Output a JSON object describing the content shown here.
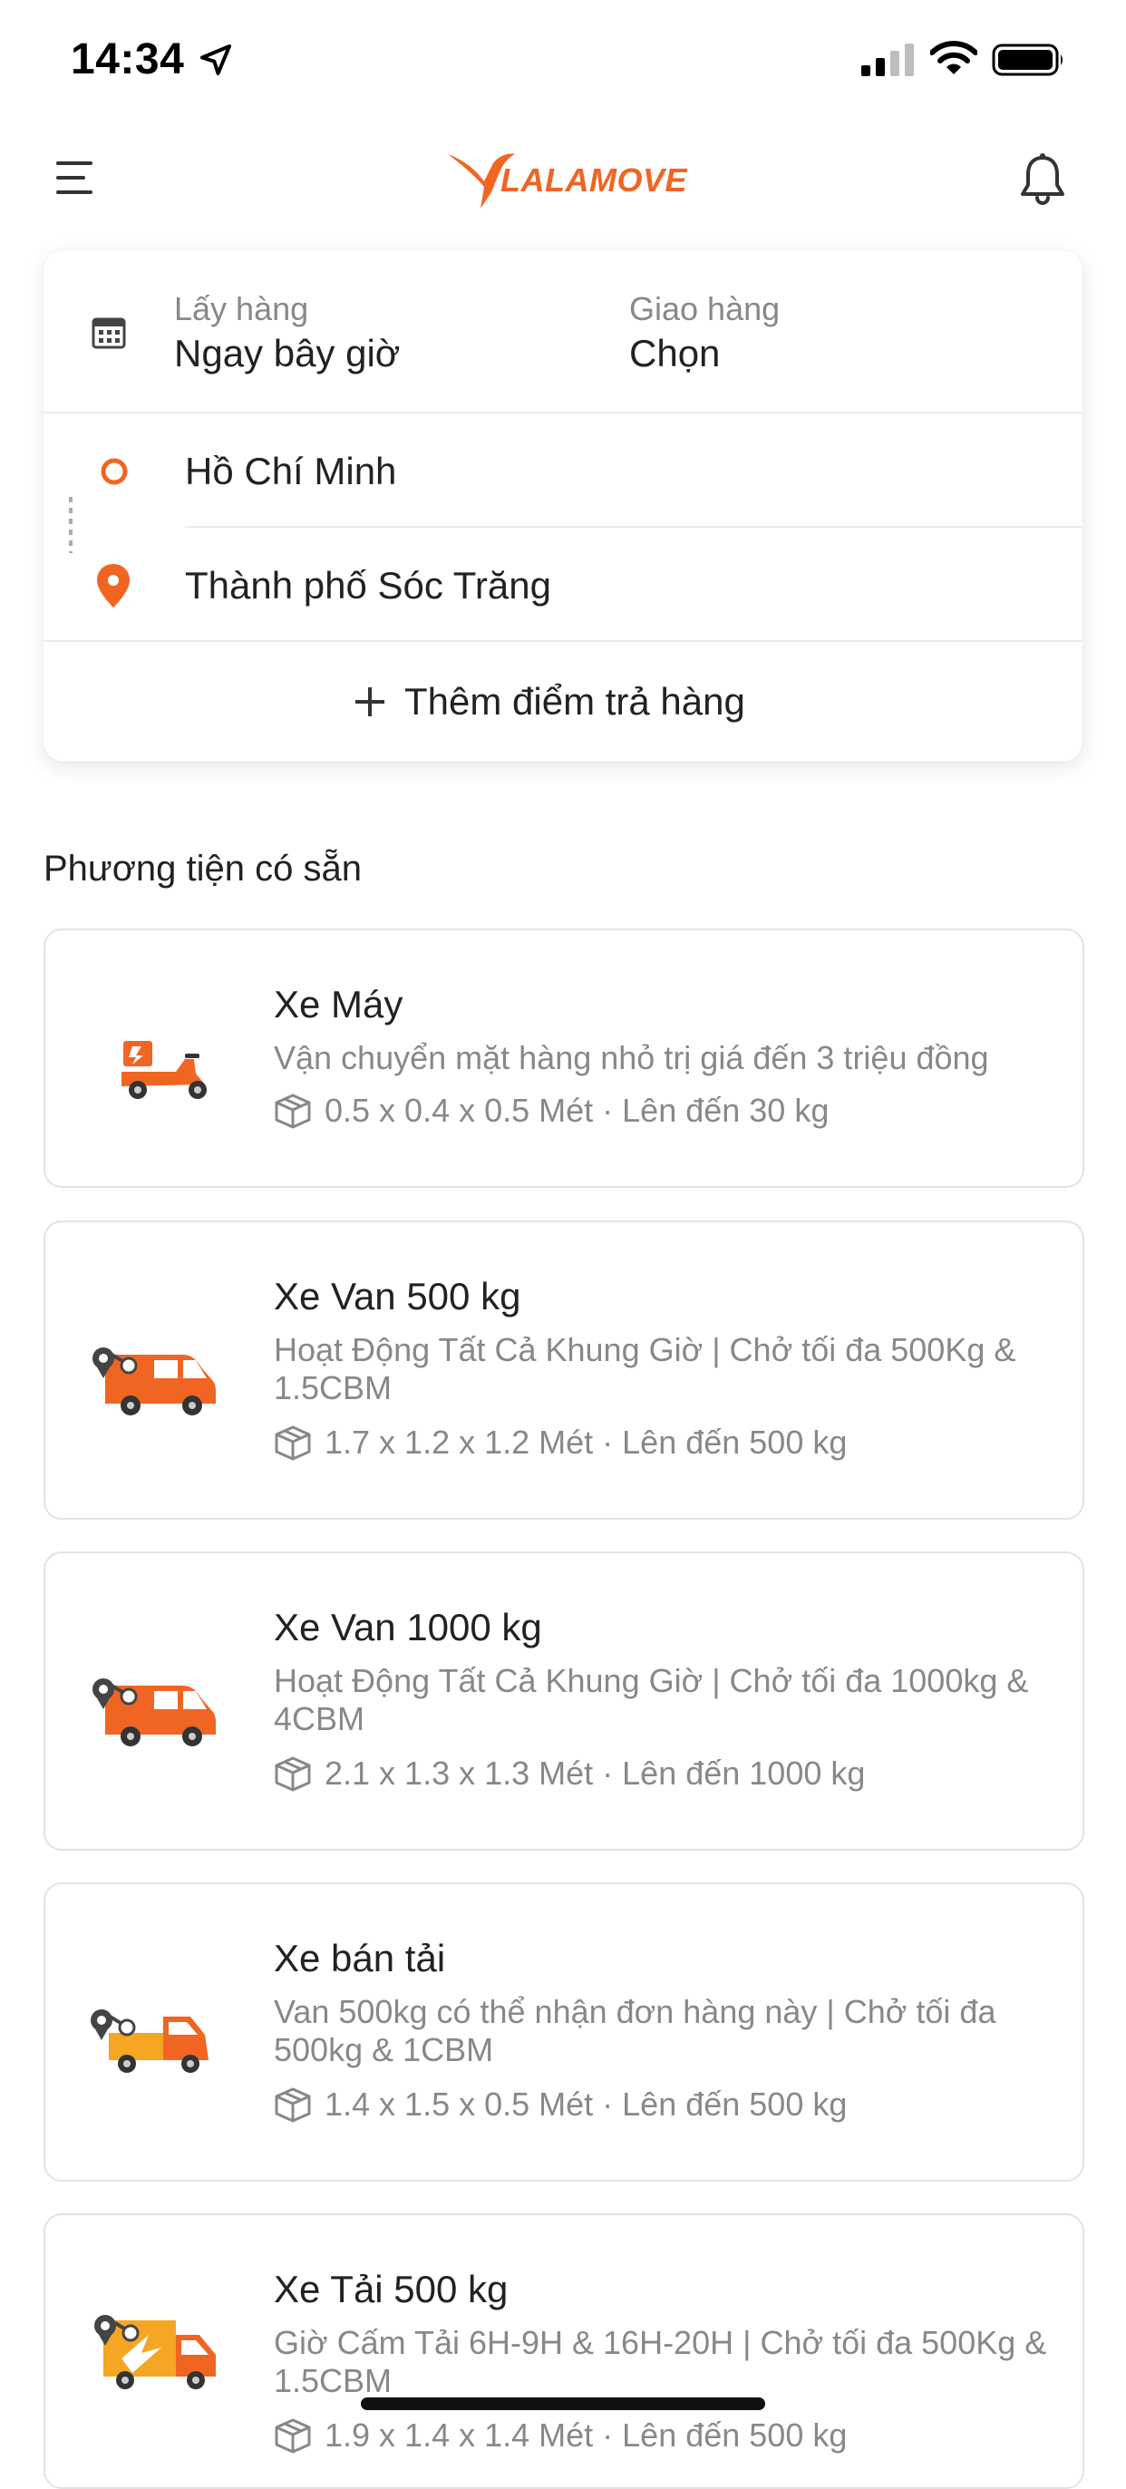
{
  "status_bar": {
    "time": "14:34"
  },
  "header": {
    "logo_text": "LALAMOVE",
    "brand_color": "#f16522"
  },
  "schedule": {
    "pickup_label": "Lấy hàng",
    "pickup_value": "Ngay bây giờ",
    "delivery_label": "Giao hàng",
    "delivery_value": "Chọn"
  },
  "route": {
    "origin": "Hồ Chí Minh",
    "destination": "Thành phố Sóc Trăng",
    "add_stop_label": "Thêm điểm trả hàng"
  },
  "vehicles_section": {
    "title": "Phương tiện có sẵn",
    "items": [
      {
        "name": "Xe Máy",
        "description": "Vận chuyển mặt hàng nhỏ trị giá đến 3 triệu đồng",
        "specs": "0.5 x 0.4 x 0.5 Mét · Lên đến 30 kg",
        "icon": "motorbike-icon"
      },
      {
        "name": "Xe Van 500 kg",
        "description": "Hoạt Động Tất Cả Khung Giờ | Chở tối đa 500Kg & 1.5CBM",
        "specs": "1.7 x 1.2 x 1.2 Mét · Lên đến 500 kg",
        "icon": "van-icon"
      },
      {
        "name": "Xe Van 1000 kg",
        "description": "Hoạt Động Tất Cả Khung Giờ | Chở tối đa 1000kg & 4CBM",
        "specs": "2.1 x 1.3 x 1.3 Mét · Lên đến 1000 kg",
        "icon": "van-icon"
      },
      {
        "name": "Xe bán tải",
        "description": "Van 500kg có thể nhận đơn hàng này | Chở tối đa 500kg & 1CBM",
        "specs": "1.4 x 1.5 x 0.5 Mét · Lên đến 500 kg",
        "icon": "pickup-truck-icon"
      },
      {
        "name": "Xe Tải 500 kg",
        "description": "Giờ Cấm Tải 6H-9H & 16H-20H | Chở tối đa 500Kg & 1.5CBM",
        "specs": "1.9 x 1.4 x 1.4 Mét · Lên đến 500 kg",
        "icon": "truck-icon"
      }
    ]
  }
}
